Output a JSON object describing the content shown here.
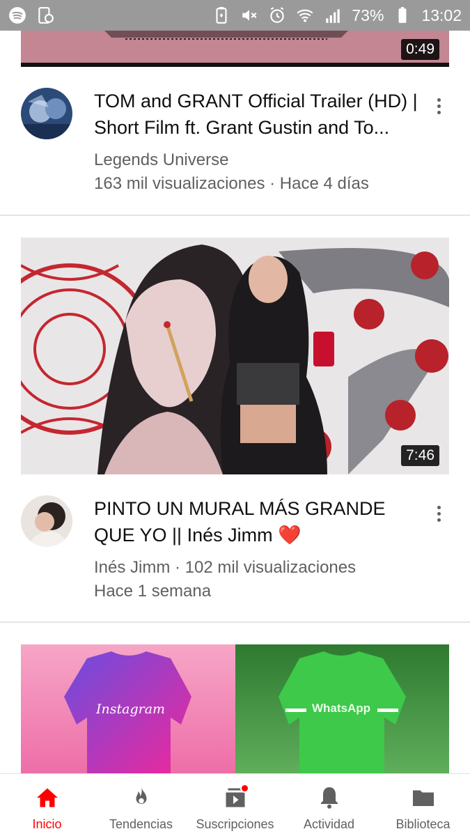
{
  "status_bar": {
    "battery": "73%",
    "time": "13:02",
    "left_icons": [
      "spotify-icon",
      "screen-icon"
    ],
    "right_icons": [
      "battery-saver-icon",
      "mute-icon",
      "alarm-icon",
      "wifi-icon",
      "signal-icon",
      "battery-icon"
    ]
  },
  "videos": [
    {
      "duration": "0:49",
      "title": "",
      "channel": "",
      "stats": ""
    },
    {
      "title": "TOM and GRANT Official Trailer (HD) | Short Film ft. Grant Gustin and To...",
      "channel": "Legends Universe",
      "stats": "163 mil visualizaciones · Hace 4 días"
    },
    {
      "duration": "7:46",
      "title": "PINTO UN MURAL MÁS GRANDE QUE YO || Inés Jimm ❤️",
      "line1": "Inés Jimm · 102 mil visualizaciones",
      "line2": "Hace 1 semana"
    },
    {
      "thumb_left_label": "Instagram",
      "thumb_right_label": "WhatsApp"
    }
  ],
  "bottom_nav": {
    "items": [
      {
        "label": "Inicio",
        "icon": "home-icon",
        "active": true
      },
      {
        "label": "Tendencias",
        "icon": "fire-icon",
        "active": false
      },
      {
        "label": "Suscripciones",
        "icon": "subscriptions-icon",
        "active": false
      },
      {
        "label": "Actividad",
        "icon": "bell-icon",
        "active": false
      },
      {
        "label": "Biblioteca",
        "icon": "folder-icon",
        "active": false
      }
    ]
  },
  "colors": {
    "accent": "#ff0000",
    "text_secondary": "#606060",
    "statusbar_bg": "#9a9a9a"
  }
}
